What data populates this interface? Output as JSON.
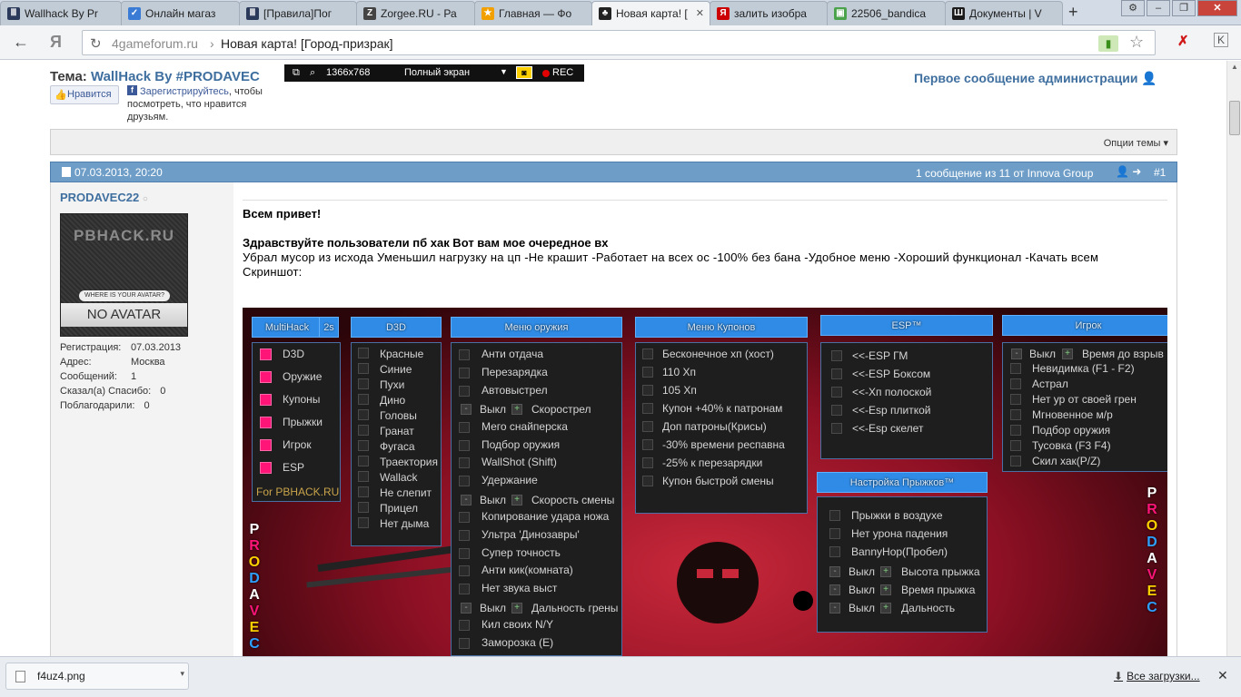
{
  "browser": {
    "tabs": [
      {
        "label": "Wallhack By Pr",
        "icon": "game-site-icon",
        "color": "#2b3a5a"
      },
      {
        "label": "Онлайн магаз",
        "icon": "check-icon",
        "color": "#3a7bd5"
      },
      {
        "label": "[Правила]Пог",
        "icon": "game-site-icon",
        "color": "#2b3a5a"
      },
      {
        "label": "Zorgee.RU - Ра",
        "icon": "zorgee-icon",
        "color": "#444444"
      },
      {
        "label": "Главная — Фо",
        "icon": "forum-icon",
        "color": "#f2a000"
      },
      {
        "label": "Новая карта! [",
        "icon": "clover-icon",
        "color": "#222222",
        "active": true
      },
      {
        "label": "залить изобра",
        "icon": "yandex-icon",
        "color": "#cc0000"
      },
      {
        "label": "22506_bandica",
        "icon": "image-icon",
        "color": "#4aa24a"
      },
      {
        "label": "Документы | V",
        "icon": "document-icon",
        "color": "#1a1a1a"
      }
    ],
    "url_host": "4gameforum.ru",
    "url_separator": "›",
    "url_title": "Новая карта! [Город-призрак]"
  },
  "header": {
    "theme_prefix": "Тема:",
    "theme_title": "WallHack By #PRODAVEC",
    "like_label": "Нравится",
    "fb_register": "Зарегистрируйтесь",
    "fb_text": ", чтобы посмотреть, что нравится друзьям.",
    "first_message": "Первое сообщение администрации"
  },
  "recorder": {
    "resolution": "1366x768",
    "mode": "Полный экран",
    "rec": "REC"
  },
  "options": {
    "label": "Опции темы"
  },
  "post": {
    "date": "07.03.2013, 20:20",
    "count_text": "1 сообщение из 11 от Innova Group",
    "number": "#1"
  },
  "user": {
    "name": "PRODAVEC22",
    "avatar_site": "PBHACK.RU",
    "avatar_question": "WHERE IS YOUR AVATAR?",
    "avatar_text": "NO AVATAR",
    "info": [
      {
        "key": "Регистрация:",
        "value": "07.03.2013"
      },
      {
        "key": "Адрес:",
        "value": "Москва"
      },
      {
        "key": "Сообщений:",
        "value": "1"
      },
      {
        "key": "Сказал(а) Спасибо:",
        "value": "0"
      },
      {
        "key": "Поблагодарили:",
        "value": "0"
      }
    ]
  },
  "message": {
    "line1": "Всем привет!",
    "line2": "Здравствуйте пользователи пб хак Вот вам мое очередное вх",
    "line3": "Убрал мусор из исхода Уменьшил нагрузку на цп -Не крашит -Работает на всех ос -100% без бана -Удобное меню -Хороший функционал -Качать всем Скриншот:"
  },
  "cheat_menu": {
    "multihack": {
      "title": "MultiHack",
      "tab": "2s",
      "items": [
        "D3D",
        "Оружие",
        "Купоны",
        "Прыжки",
        "Игрок",
        "ESP"
      ],
      "footer": "For PBHACK.RU"
    },
    "d3d": {
      "title": "D3D",
      "items": [
        "Красные",
        "Синие",
        "Пухи",
        "Дино",
        "Головы",
        "Гранат",
        "Фугаса",
        "Траектория",
        "Wallack",
        "Не слепит",
        "Прицел",
        "Нет дыма"
      ]
    },
    "weapons": {
      "title": "Меню оружия",
      "items": [
        "Анти отдача",
        "Перезарядка",
        "Автовыстрел",
        "Скорострел",
        "Мего снайперска",
        "Подбор оружия",
        "WallShot (Shift)",
        "Удержание",
        "Скорость смены",
        "Копирование удара ножа",
        "Ультра 'Динозавры'",
        "Супер точность",
        "Анти кик(комната)",
        "Нет звука выст",
        "Дальность грены",
        "Кил своих N/Y",
        "Заморозка (E)"
      ],
      "toggle_label": "Выкл"
    },
    "coupons": {
      "title": "Меню Купонов",
      "items": [
        "Бесконечное хп (хост)",
        "110 Хп",
        "105 Хп",
        "Купон +40% к патронам",
        "Доп патроны(Крисы)",
        "-30% времени респавна",
        "-25% к перезарядки",
        "Купон быстрой смены"
      ]
    },
    "esp": {
      "title": "ESP™",
      "items": [
        "<<-ESP ГМ",
        "<<-ESP Боксом",
        "<<-Хп полоской",
        "<<-Esp плиткой",
        "<<-Esp скелет"
      ]
    },
    "player": {
      "title": "Игрок",
      "toggle_label": "Выкл",
      "first": "Время до взрыв",
      "items": [
        "Невидимка (F1 - F2)",
        "Астрал",
        "Нет ур от своей грен",
        "Мгновенное м/р",
        "Подбор оружия",
        "Тусовка (F3 F4)",
        "Скил хак(P/Z)"
      ]
    },
    "jumps": {
      "title": "Настройка Прыжков™",
      "items": [
        "Прыжки в воздухе",
        "Нет урона падения",
        "BannyHop(Пробел)"
      ],
      "toggles": [
        "Высота прыжка",
        "Время прыжка",
        "Дальность"
      ],
      "toggle_label": "Выкл"
    },
    "side_logo": "PRODAVEC"
  },
  "downloads": {
    "file": "f4uz4.png",
    "all_label": "Все загрузки..."
  }
}
